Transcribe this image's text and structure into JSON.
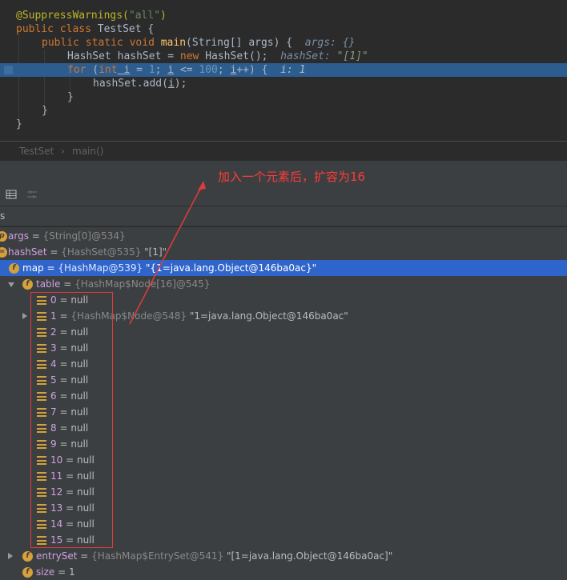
{
  "editor": {
    "lines": [
      {
        "annotation": "@SuppressWarnings(",
        "arg": "\"all\"",
        "close": ")"
      },
      {
        "kw1": "public",
        "kw2": "class",
        "name": "TestSet",
        "rest": " {"
      },
      {
        "kw1": "public",
        "kw2": "static",
        "kw3": "void",
        "fn": "main",
        "sig": "(String[] args) {",
        "hint": "args: {}"
      },
      {
        "type": "HashSet",
        "decl": " hashSet = ",
        "kw": "new",
        "ctor": " HashSet",
        "end": "();",
        "hint_name": "hashSet:",
        "hint_val": "\"[1]\""
      },
      {
        "kw": "for",
        "open": " (",
        "kw2": "int",
        "var": " i",
        "mid": " = ",
        "n1": "1",
        "semi": "; ",
        "var2": "i",
        "cmp": " <= ",
        "n2": "100",
        "semi2": "; ",
        "var3": "i",
        "inc": "++) {",
        "hint": "i: 1"
      },
      {
        "obj": "hashSet.",
        "method": "add",
        "open": "(",
        "arg": "i",
        "end": ");"
      },
      {
        "text": "}"
      },
      {
        "text": "}"
      },
      {
        "text": "}"
      }
    ]
  },
  "breadcrumb": {
    "class": "TestSet",
    "sep": "›",
    "method": "main()"
  },
  "frames_label": "s",
  "annotation_text": "加入一个元素后，扩容为16",
  "variables": {
    "args": {
      "name": "args",
      "eq": " = ",
      "type": "{String[0]@534}"
    },
    "hashSet": {
      "name": "hashSet",
      "eq": " = ",
      "type": "{HashSet@535}",
      "value": " \"[1]\""
    },
    "map": {
      "name": "map",
      "eq": " = ",
      "type": "{HashMap@539}",
      "value": " \"{1=java.lang.Object@146ba0ac}\""
    },
    "table": {
      "name": "table",
      "eq": " = ",
      "type": "{HashMap$Node[16]@545}"
    },
    "table_items": [
      {
        "idx": "0",
        "rest": " = null"
      },
      {
        "idx": "1",
        "rest": " = ",
        "type": "{HashMap$Node@548}",
        "value": " \"1=java.lang.Object@146ba0ac\""
      },
      {
        "idx": "2",
        "rest": " = null"
      },
      {
        "idx": "3",
        "rest": " = null"
      },
      {
        "idx": "4",
        "rest": " = null"
      },
      {
        "idx": "5",
        "rest": " = null"
      },
      {
        "idx": "6",
        "rest": " = null"
      },
      {
        "idx": "7",
        "rest": " = null"
      },
      {
        "idx": "8",
        "rest": " = null"
      },
      {
        "idx": "9",
        "rest": " = null"
      },
      {
        "idx": "10",
        "rest": " = null"
      },
      {
        "idx": "11",
        "rest": " = null"
      },
      {
        "idx": "12",
        "rest": " = null"
      },
      {
        "idx": "13",
        "rest": " = null"
      },
      {
        "idx": "14",
        "rest": " = null"
      },
      {
        "idx": "15",
        "rest": " = null"
      }
    ],
    "entrySet": {
      "name": "entrySet",
      "eq": " = ",
      "type": "{HashMap$EntrySet@541}",
      "value": " \"[1=java.lang.Object@146ba0ac]\""
    },
    "size": {
      "name": "size",
      "eq": " = ",
      "value": "1"
    }
  },
  "colors": {
    "selection": "#2f65ca",
    "highlight_line": "#2d5c8f",
    "annotation": "#ff3b3b",
    "field_icon": "#d6a13b"
  }
}
